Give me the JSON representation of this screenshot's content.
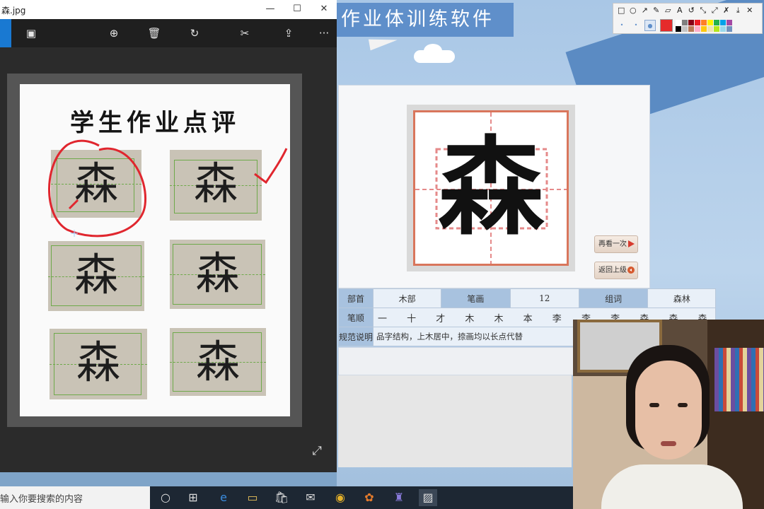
{
  "viewer": {
    "title": "森.jpg",
    "controls": {
      "minimize": "—",
      "maximize": "☐",
      "close": "✕"
    },
    "toolbar_icons": [
      "slideshow-icon",
      "zoom-icon",
      "delete-icon",
      "rotate-icon",
      "edit-icon",
      "share-icon",
      "more-icon"
    ],
    "toolbar_glyphs": {
      "slideshow": "▣",
      "zoom": "⊕",
      "delete": "🗑",
      "rotate": "↻",
      "edit": "✂",
      "share": "⇪",
      "more": "···"
    },
    "photo": {
      "heading": "学生作业点评",
      "sample_char": "森"
    },
    "expand_glyph": "⤢"
  },
  "app": {
    "title": "作业体训练软件",
    "big_char": "森",
    "btn_again": "再看一次",
    "btn_back": "返回上级",
    "table": {
      "radical_label": "部首",
      "radical_value": "木部",
      "strokes_label": "笔画",
      "strokes_value": "12",
      "words_label": "组词",
      "words_value": "森林",
      "order_label": "笔顺",
      "order_value": "一 十 才 木 木 本 李 李 李 森 森 森",
      "desc_label": "规范说明",
      "desc_value": "品字结构，上木居中，捺画均以长点代替"
    }
  },
  "draw_toolbar": {
    "tools": [
      "□",
      "○",
      "↗",
      "✎",
      "▱",
      "A",
      "↺",
      "⤡",
      "⤢",
      "✗",
      "⤓",
      "✕"
    ],
    "dots": [
      "•",
      "•",
      "●"
    ],
    "current_color": "#e52b2b",
    "palette": [
      "#ffffff",
      "#7f7f7f",
      "#880015",
      "#ed1c24",
      "#ff7f27",
      "#fff200",
      "#22b14c",
      "#00a2e8",
      "#a349a4",
      "#000000",
      "#c3c3c3",
      "#b97a57",
      "#ffaec9",
      "#ffc90e",
      "#efe4b0",
      "#b5e61d",
      "#99d9ea",
      "#7092be"
    ]
  },
  "taskbar": {
    "search_text": "输入你要搜索的内容",
    "apps": [
      "○",
      "⊞",
      "e",
      "▭",
      "🛍",
      "✉",
      "◉",
      "✿",
      "♜",
      "▨"
    ]
  },
  "colors": {
    "accent_blue": "#5f8fca",
    "annotation_red": "#e0262e",
    "grid_red": "#d9765c"
  }
}
